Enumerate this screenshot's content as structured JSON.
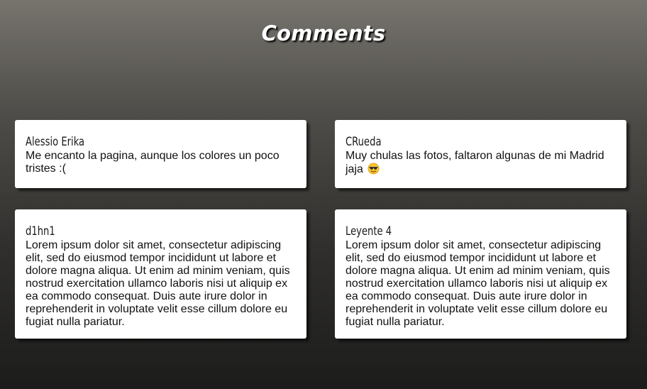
{
  "page": {
    "title": "Comments"
  },
  "comments": [
    {
      "author": "Alessio Erika",
      "text": "Me encanto la pagina, aunque los colores un poco tristes :("
    },
    {
      "author": "CRueda",
      "text": "Muy chulas las fotos, faltaron algunas de mi Madrid jaja",
      "emoji": "sunglasses-face-emoji"
    },
    {
      "author": "d1hn1",
      "text": "Lorem ipsum dolor sit amet, consectetur adipiscing elit, sed do eiusmod tempor incididunt ut labore et dolore magna aliqua. Ut enim ad minim veniam, quis nostrud exercitation ullamco laboris nisi ut aliquip ex ea commodo consequat. Duis aute irure dolor in reprehenderit in voluptate velit esse cillum dolore eu fugiat nulla pariatur."
    },
    {
      "author": "Leyente 4",
      "text": "Lorem ipsum dolor sit amet, consectetur adipiscing elit, sed do eiusmod tempor incididunt ut labore et dolore magna aliqua. Ut enim ad minim veniam, quis nostrud exercitation ullamco laboris nisi ut aliquip ex ea commodo consequat. Duis aute irure dolor in reprehenderit in voluptate velit esse cillum dolore eu fugiat nulla pariatur."
    }
  ],
  "colors": {
    "card_background": "#ffffff",
    "title_color": "#ffffff",
    "text_color": "#111111"
  }
}
